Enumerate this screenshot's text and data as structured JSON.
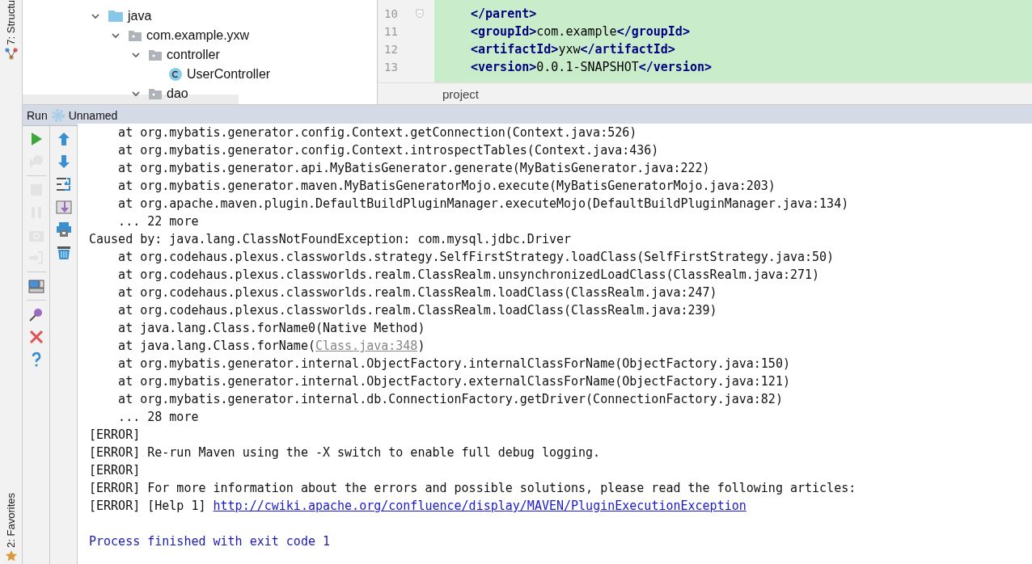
{
  "side_tabs": [
    {
      "label": "7: Structu",
      "kind": "structure"
    },
    {
      "label": "2: Favorites",
      "kind": "favorites"
    }
  ],
  "project_tree": [
    {
      "label": "java",
      "kind": "source-folder",
      "expanded": true,
      "children": [
        {
          "label": "com.example.yxw",
          "kind": "package",
          "expanded": true,
          "children": [
            {
              "label": "controller",
              "kind": "package",
              "expanded": true,
              "children": [
                {
                  "label": "UserController",
                  "kind": "class"
                }
              ]
            },
            {
              "label": "dao",
              "kind": "package",
              "expanded": true
            }
          ]
        }
      ]
    }
  ],
  "editor": {
    "lines": [
      {
        "number": "10",
        "fold": true,
        "parts": [
          {
            "kind": "tag",
            "text": "</parent>"
          }
        ]
      },
      {
        "number": "11",
        "fold": false,
        "parts": [
          {
            "kind": "tag",
            "text": "<groupId>"
          },
          {
            "kind": "value",
            "text": "com.example"
          },
          {
            "kind": "tag",
            "text": "</groupId>"
          }
        ]
      },
      {
        "number": "12",
        "fold": false,
        "parts": [
          {
            "kind": "tag",
            "text": "<artifactId>"
          },
          {
            "kind": "value",
            "text": "yxw"
          },
          {
            "kind": "tag",
            "text": "</artifactId>"
          }
        ]
      },
      {
        "number": "13",
        "fold": false,
        "parts": [
          {
            "kind": "tag",
            "text": "<version>"
          },
          {
            "kind": "value",
            "text": "0.0.1-SNAPSHOT"
          },
          {
            "kind": "tag",
            "text": "</version>"
          }
        ]
      }
    ],
    "breadcrumb": "project"
  },
  "run_bar": {
    "label": "Run",
    "config": "Unnamed"
  },
  "run_toolbar": [
    {
      "kind": "run",
      "disabled": false
    },
    {
      "kind": "rerun",
      "disabled": true
    },
    {
      "kind": "stop",
      "disabled": true
    },
    {
      "kind": "pause",
      "disabled": true
    },
    {
      "kind": "camera",
      "disabled": true
    },
    {
      "kind": "exit",
      "disabled": true
    },
    {
      "kind": "layout",
      "disabled": false
    },
    {
      "kind": "pin",
      "disabled": false
    },
    {
      "kind": "close",
      "disabled": false
    },
    {
      "kind": "help",
      "disabled": false
    }
  ],
  "console": [
    [
      {
        "kind": "plain",
        "text": "    at org.mybatis.generator.config.Context.getConnection(Context.java:526)"
      }
    ],
    [
      {
        "kind": "plain",
        "text": "    at org.mybatis.generator.config.Context.introspectTables(Context.java:436)"
      }
    ],
    [
      {
        "kind": "plain",
        "text": "    at org.mybatis.generator.api.MyBatisGenerator.generate(MyBatisGenerator.java:222)"
      }
    ],
    [
      {
        "kind": "plain",
        "text": "    at org.mybatis.generator.maven.MyBatisGeneratorMojo.execute(MyBatisGeneratorMojo.java:203)"
      }
    ],
    [
      {
        "kind": "plain",
        "text": "    at org.apache.maven.plugin.DefaultBuildPluginManager.executeMojo(DefaultBuildPluginManager.java:134)"
      }
    ],
    [
      {
        "kind": "plain",
        "text": "    ... 22 more"
      }
    ],
    [
      {
        "kind": "plain",
        "text": "Caused by: java.lang.ClassNotFoundException: com.mysql.jdbc.Driver"
      }
    ],
    [
      {
        "kind": "plain",
        "text": "    at org.codehaus.plexus.classworlds.strategy.SelfFirstStrategy.loadClass(SelfFirstStrategy.java:50)"
      }
    ],
    [
      {
        "kind": "plain",
        "text": "    at org.codehaus.plexus.classworlds.realm.ClassRealm.unsynchronizedLoadClass(ClassRealm.java:271)"
      }
    ],
    [
      {
        "kind": "plain",
        "text": "    at org.codehaus.plexus.classworlds.realm.ClassRealm.loadClass(ClassRealm.java:247)"
      }
    ],
    [
      {
        "kind": "plain",
        "text": "    at org.codehaus.plexus.classworlds.realm.ClassRealm.loadClass(ClassRealm.java:239)"
      }
    ],
    [
      {
        "kind": "plain",
        "text": "    at java.lang.Class.forName0(Native Method)"
      }
    ],
    [
      {
        "kind": "plain",
        "text": "    at java.lang.Class.forName("
      },
      {
        "kind": "file-link",
        "text": "Class.java:348"
      },
      {
        "kind": "plain",
        "text": ")"
      }
    ],
    [
      {
        "kind": "plain",
        "text": "    at org.mybatis.generator.internal.ObjectFactory.internalClassForName(ObjectFactory.java:150)"
      }
    ],
    [
      {
        "kind": "plain",
        "text": "    at org.mybatis.generator.internal.ObjectFactory.externalClassForName(ObjectFactory.java:121)"
      }
    ],
    [
      {
        "kind": "plain",
        "text": "    at org.mybatis.generator.internal.db.ConnectionFactory.getDriver(ConnectionFactory.java:82)"
      }
    ],
    [
      {
        "kind": "plain",
        "text": "    ... 28 more"
      }
    ],
    [
      {
        "kind": "plain",
        "text": "[ERROR]"
      }
    ],
    [
      {
        "kind": "plain",
        "text": "[ERROR] Re-run Maven using the -X switch to enable full debug logging."
      }
    ],
    [
      {
        "kind": "plain",
        "text": "[ERROR]"
      }
    ],
    [
      {
        "kind": "plain",
        "text": "[ERROR] For more information about the errors and possible solutions, please read the following articles:"
      }
    ],
    [
      {
        "kind": "plain",
        "text": "[ERROR] [Help 1] "
      },
      {
        "kind": "link",
        "text": "http://cwiki.apache.org/confluence/display/MAVEN/PluginExecutionException"
      }
    ]
  ],
  "exit_message": "Process finished with exit code 1"
}
